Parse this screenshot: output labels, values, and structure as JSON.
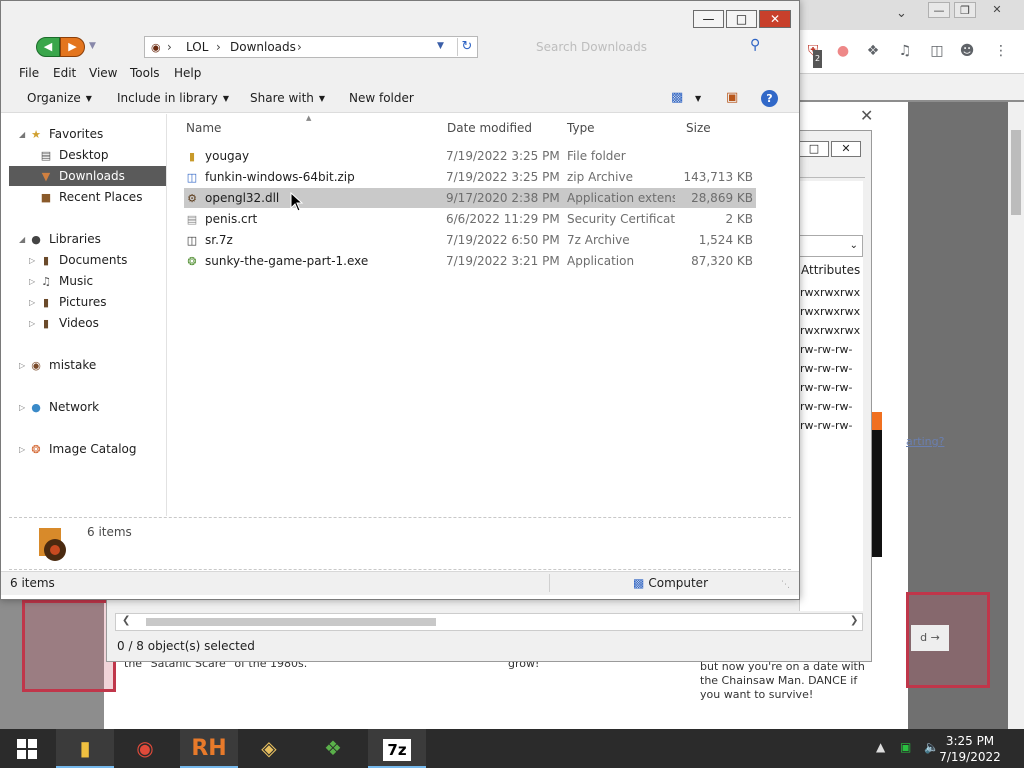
{
  "explorer": {
    "address": {
      "crumbs": [
        "LOL",
        "Downloads"
      ]
    },
    "search": {
      "placeholder": "Search Downloads"
    },
    "menus": [
      "File",
      "Edit",
      "View",
      "Tools",
      "Help"
    ],
    "commands": {
      "organize": "Organize",
      "include": "Include in library",
      "share": "Share with",
      "new_folder": "New folder"
    },
    "nav": {
      "favorites": "Favorites",
      "desktop": "Desktop",
      "downloads": "Downloads",
      "recent": "Recent Places",
      "libraries": "Libraries",
      "documents": "Documents",
      "music": "Music",
      "pictures": "Pictures",
      "videos": "Videos",
      "mistake": "mistake",
      "network": "Network",
      "catalog": "Image Catalog"
    },
    "columns": {
      "name": "Name",
      "date": "Date modified",
      "type": "Type",
      "size": "Size"
    },
    "files": [
      {
        "name": "yougay",
        "date": "7/19/2022 3:25 PM",
        "type": "File folder",
        "size": "",
        "icon": "folder-icon"
      },
      {
        "name": "funkin-windows-64bit.zip",
        "date": "7/19/2022 3:25 PM",
        "type": "zip Archive",
        "size": "143,713 KB",
        "icon": "zip-archive-icon"
      },
      {
        "name": "opengl32.dll",
        "date": "9/17/2020 2:38 PM",
        "type": "Application extens...",
        "size": "28,869 KB",
        "icon": "dll-file-icon"
      },
      {
        "name": "penis.crt",
        "date": "6/6/2022 11:29 PM",
        "type": "Security Certificate",
        "size": "2 KB",
        "icon": "certificate-icon"
      },
      {
        "name": "sr.7z",
        "date": "7/19/2022 6:50 PM",
        "type": "7z Archive",
        "size": "1,524 KB",
        "icon": "7z-archive-icon"
      },
      {
        "name": "sunky-the-game-part-1.exe",
        "date": "7/19/2022 3:21 PM",
        "type": "Application",
        "size": "87,320 KB",
        "icon": "exe-file-icon"
      }
    ],
    "details_count": "6 items",
    "status": {
      "items": "6 items",
      "location": "Computer"
    }
  },
  "archive": {
    "column": "Attributes",
    "attributes": [
      "rwxrwxrwx",
      "rwxrwxrwx",
      "rwxrwxrwx",
      "rw-rw-rw-",
      "rw-rw-rw-",
      "rw-rw-rw-",
      "rw-rw-rw-",
      "rw-rw-rw-"
    ],
    "status": "0 / 8 object(s) selected"
  },
  "browser": {
    "ext_badge": "2",
    "snippet_left": "the \"Satanic Scare\" of the 1980s.",
    "snippet_mid": "grow!",
    "snippet_right": "but now you're on a date with the Chainsaw Man. DANCE if you want to survive!",
    "link": "arting?",
    "button_text": "d →"
  },
  "taskbar": {
    "apps": [
      "start-button",
      "file-explorer",
      "chrome",
      "rh-app",
      "paint-app",
      "windows-app",
      "7zip-app"
    ],
    "rh_label": "RH",
    "sevenzip_label": "7z",
    "time": "3:25 PM",
    "date": "7/19/2022"
  },
  "colors": {
    "selection": "#c9c9c9",
    "nav_selection": "#5a5a5a",
    "close_red": "#c8402b",
    "taskbar": "#2b2b2b"
  }
}
